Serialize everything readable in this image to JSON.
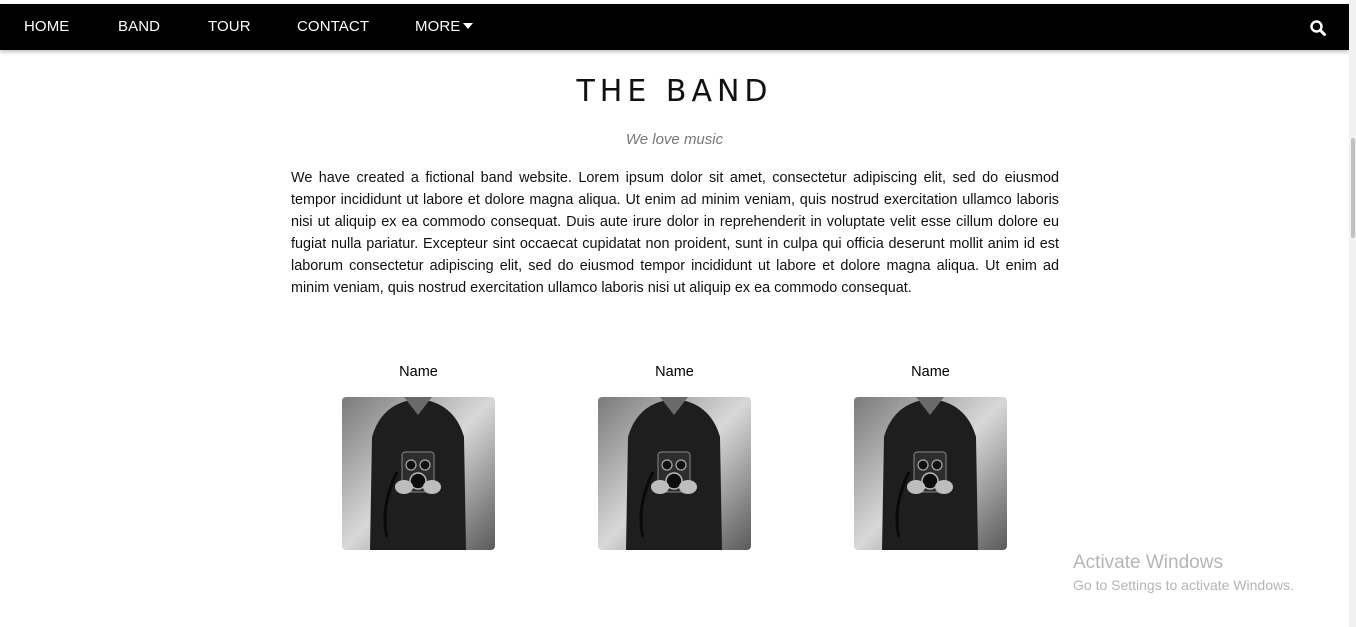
{
  "navbar": {
    "items": [
      {
        "label": "HOME"
      },
      {
        "label": "BAND"
      },
      {
        "label": "TOUR"
      },
      {
        "label": "CONTACT"
      },
      {
        "label": "MORE"
      }
    ],
    "search_icon": "search-icon",
    "more_icon": "caret-down-icon"
  },
  "band": {
    "title": "THE BAND",
    "subtitle": "We love music",
    "description": "We have created a fictional band website. Lorem ipsum dolor sit amet, consectetur adipiscing elit, sed do eiusmod tempor incididunt ut labore et dolore magna aliqua. Ut enim ad minim veniam, quis nostrud exercitation ullamco laboris nisi ut aliquip ex ea commodo consequat. Duis aute irure dolor in reprehenderit in voluptate velit esse cillum dolore eu fugiat nulla pariatur. Excepteur sint occaecat cupidatat non proident, sunt in culpa qui officia deserunt mollit anim id est laborum consectetur adipiscing elit, sed do eiusmod tempor incididunt ut labore et dolore magna aliqua. Ut enim ad minim veniam, quis nostrud exercitation ullamco laboris nisi ut aliquip ex ea commodo consequat.",
    "members": [
      {
        "name": "Name"
      },
      {
        "name": "Name"
      },
      {
        "name": "Name"
      }
    ]
  },
  "watermark": {
    "title": "Activate Windows",
    "subtitle": "Go to Settings to activate Windows."
  },
  "colors": {
    "navbar_bg": "#000000",
    "nav_text": "#ffffff",
    "subtitle": "#777777"
  }
}
